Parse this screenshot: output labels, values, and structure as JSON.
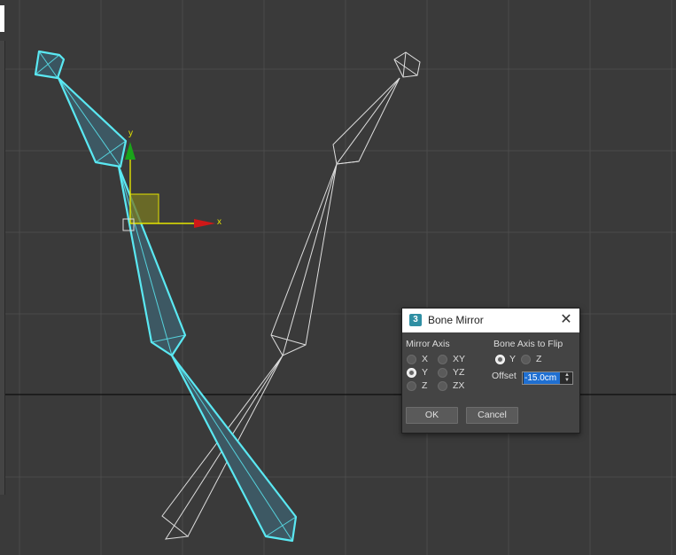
{
  "viewport": {
    "axis_x_label": "x",
    "axis_y_label": "y",
    "colors": {
      "background": "#3a3a3a",
      "grid": "#4a4a4a",
      "selected_bone": "#58e6f0",
      "wire_bone": "#dddddd",
      "gizmo_x": "#d01818",
      "gizmo_y": "#18a018",
      "gizmo_plane": "#e0e000"
    }
  },
  "dialog": {
    "title": "Bone Mirror",
    "logo": "3",
    "close_icon": "close-icon",
    "mirror_axis": {
      "label": "Mirror Axis",
      "options": [
        {
          "label": "X",
          "checked": false
        },
        {
          "label": "Y",
          "checked": true
        },
        {
          "label": "Z",
          "checked": false
        },
        {
          "label": "XY",
          "checked": false
        },
        {
          "label": "YZ",
          "checked": false
        },
        {
          "label": "ZX",
          "checked": false
        }
      ]
    },
    "bone_axis_to_flip": {
      "label": "Bone Axis to Flip",
      "options": [
        {
          "label": "Y",
          "checked": true
        },
        {
          "label": "Z",
          "checked": false
        }
      ]
    },
    "offset": {
      "label": "Offset",
      "value": "-15.0cm"
    },
    "ok_label": "OK",
    "cancel_label": "Cancel"
  }
}
